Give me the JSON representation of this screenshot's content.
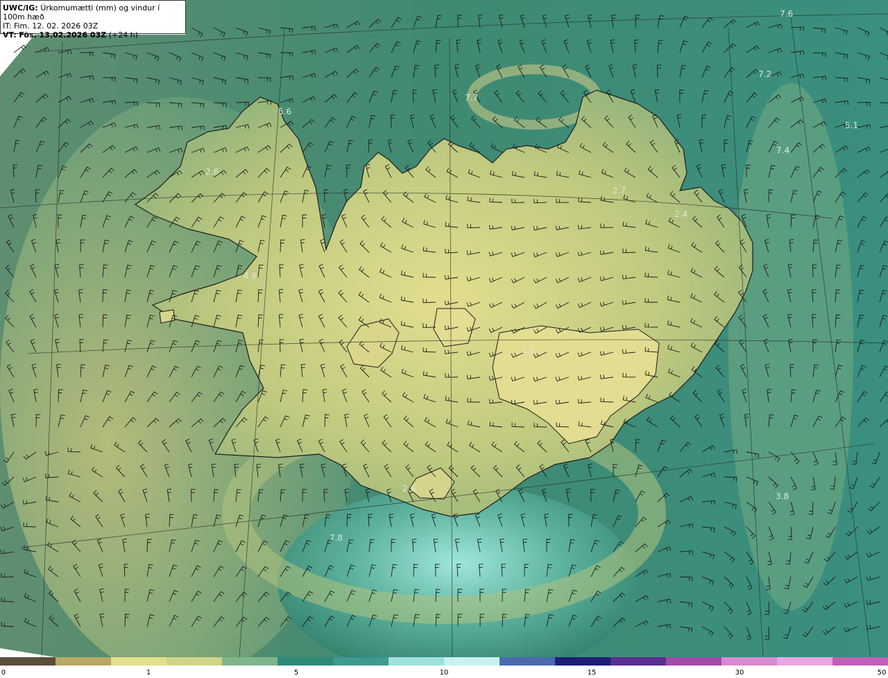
{
  "header": {
    "line1_prefix": "UWC/IG:",
    "line1_text": "Úrkomumætti (mm) og vindur í 100m hæð",
    "line2": "IT: Fim. 12. 02. 2026 03Z",
    "line3_prefix": "VT:",
    "line3_bold": "Fös. 13.02.2026 03Z",
    "line3_rest": "(+24 h)"
  },
  "value_labels": [
    "7.6",
    "7.2",
    "7.7",
    "5.6",
    "5.1",
    "7.4",
    "2.6",
    "2.7",
    "2.4",
    "4.6",
    "1.2",
    "2.6",
    "3.8",
    "7.8"
  ],
  "colorbar": {
    "ticks": [
      "0",
      "1",
      "5",
      "10",
      "15",
      "30",
      "50"
    ],
    "colors": [
      "#5a4e3a",
      "#b9a866",
      "#e2df8a",
      "#cfd48a",
      "#7fb58a",
      "#2e8a78",
      "#3d9a8c",
      "#9fe0dc",
      "#c7f2f0",
      "#4a6ab0",
      "#1e1e78",
      "#5a2e90",
      "#a04ca6",
      "#d68cd0",
      "#e8a8e4",
      "#c060b8"
    ]
  },
  "colors": {
    "ocean": "#2f7f6c",
    "land": "#b9c77e",
    "highland": "#e0dc8a",
    "coast": "#1c1c1c"
  }
}
